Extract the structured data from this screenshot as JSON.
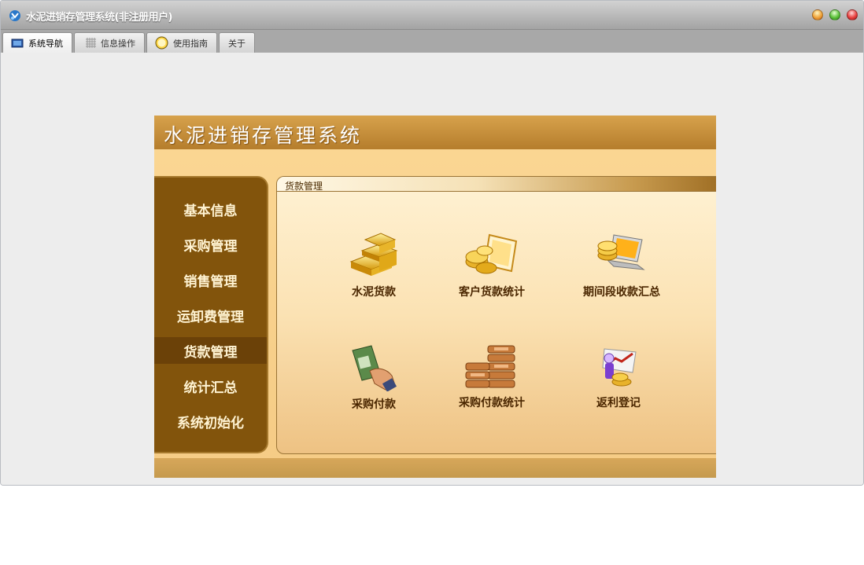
{
  "window": {
    "title": "水泥进销存管理系统(非注册用户)"
  },
  "tabs": [
    {
      "label": "系统导航",
      "icon": "monitor-icon",
      "active": true
    },
    {
      "label": "信息操作",
      "icon": "grid-icon",
      "active": false
    },
    {
      "label": "使用指南",
      "icon": "clock-icon",
      "active": false
    },
    {
      "label": "关于",
      "icon": "",
      "active": false
    }
  ],
  "panel": {
    "title": "水泥进销存管理系统"
  },
  "sidebar": {
    "items": [
      {
        "label": "基本信息"
      },
      {
        "label": "采购管理"
      },
      {
        "label": "销售管理"
      },
      {
        "label": "运卸费管理"
      },
      {
        "label": "货款管理",
        "active": true
      },
      {
        "label": "统计汇总"
      },
      {
        "label": "系统初始化"
      }
    ]
  },
  "main": {
    "section_title": "货款管理",
    "functions": [
      {
        "label": "水泥货款",
        "icon": "gold-bars-icon"
      },
      {
        "label": "客户货款统计",
        "icon": "coins-document-icon"
      },
      {
        "label": "期间段收款汇总",
        "icon": "laptop-coins-icon"
      },
      {
        "label": "采购付款",
        "icon": "hand-cash-icon"
      },
      {
        "label": "采购付款统计",
        "icon": "coin-stack-icon"
      },
      {
        "label": "返利登记",
        "icon": "person-chart-icon"
      }
    ]
  },
  "colors": {
    "sidebar_bg": "#82540c",
    "sidebar_active": "#6b4108",
    "header_gold": "#c08a36"
  }
}
